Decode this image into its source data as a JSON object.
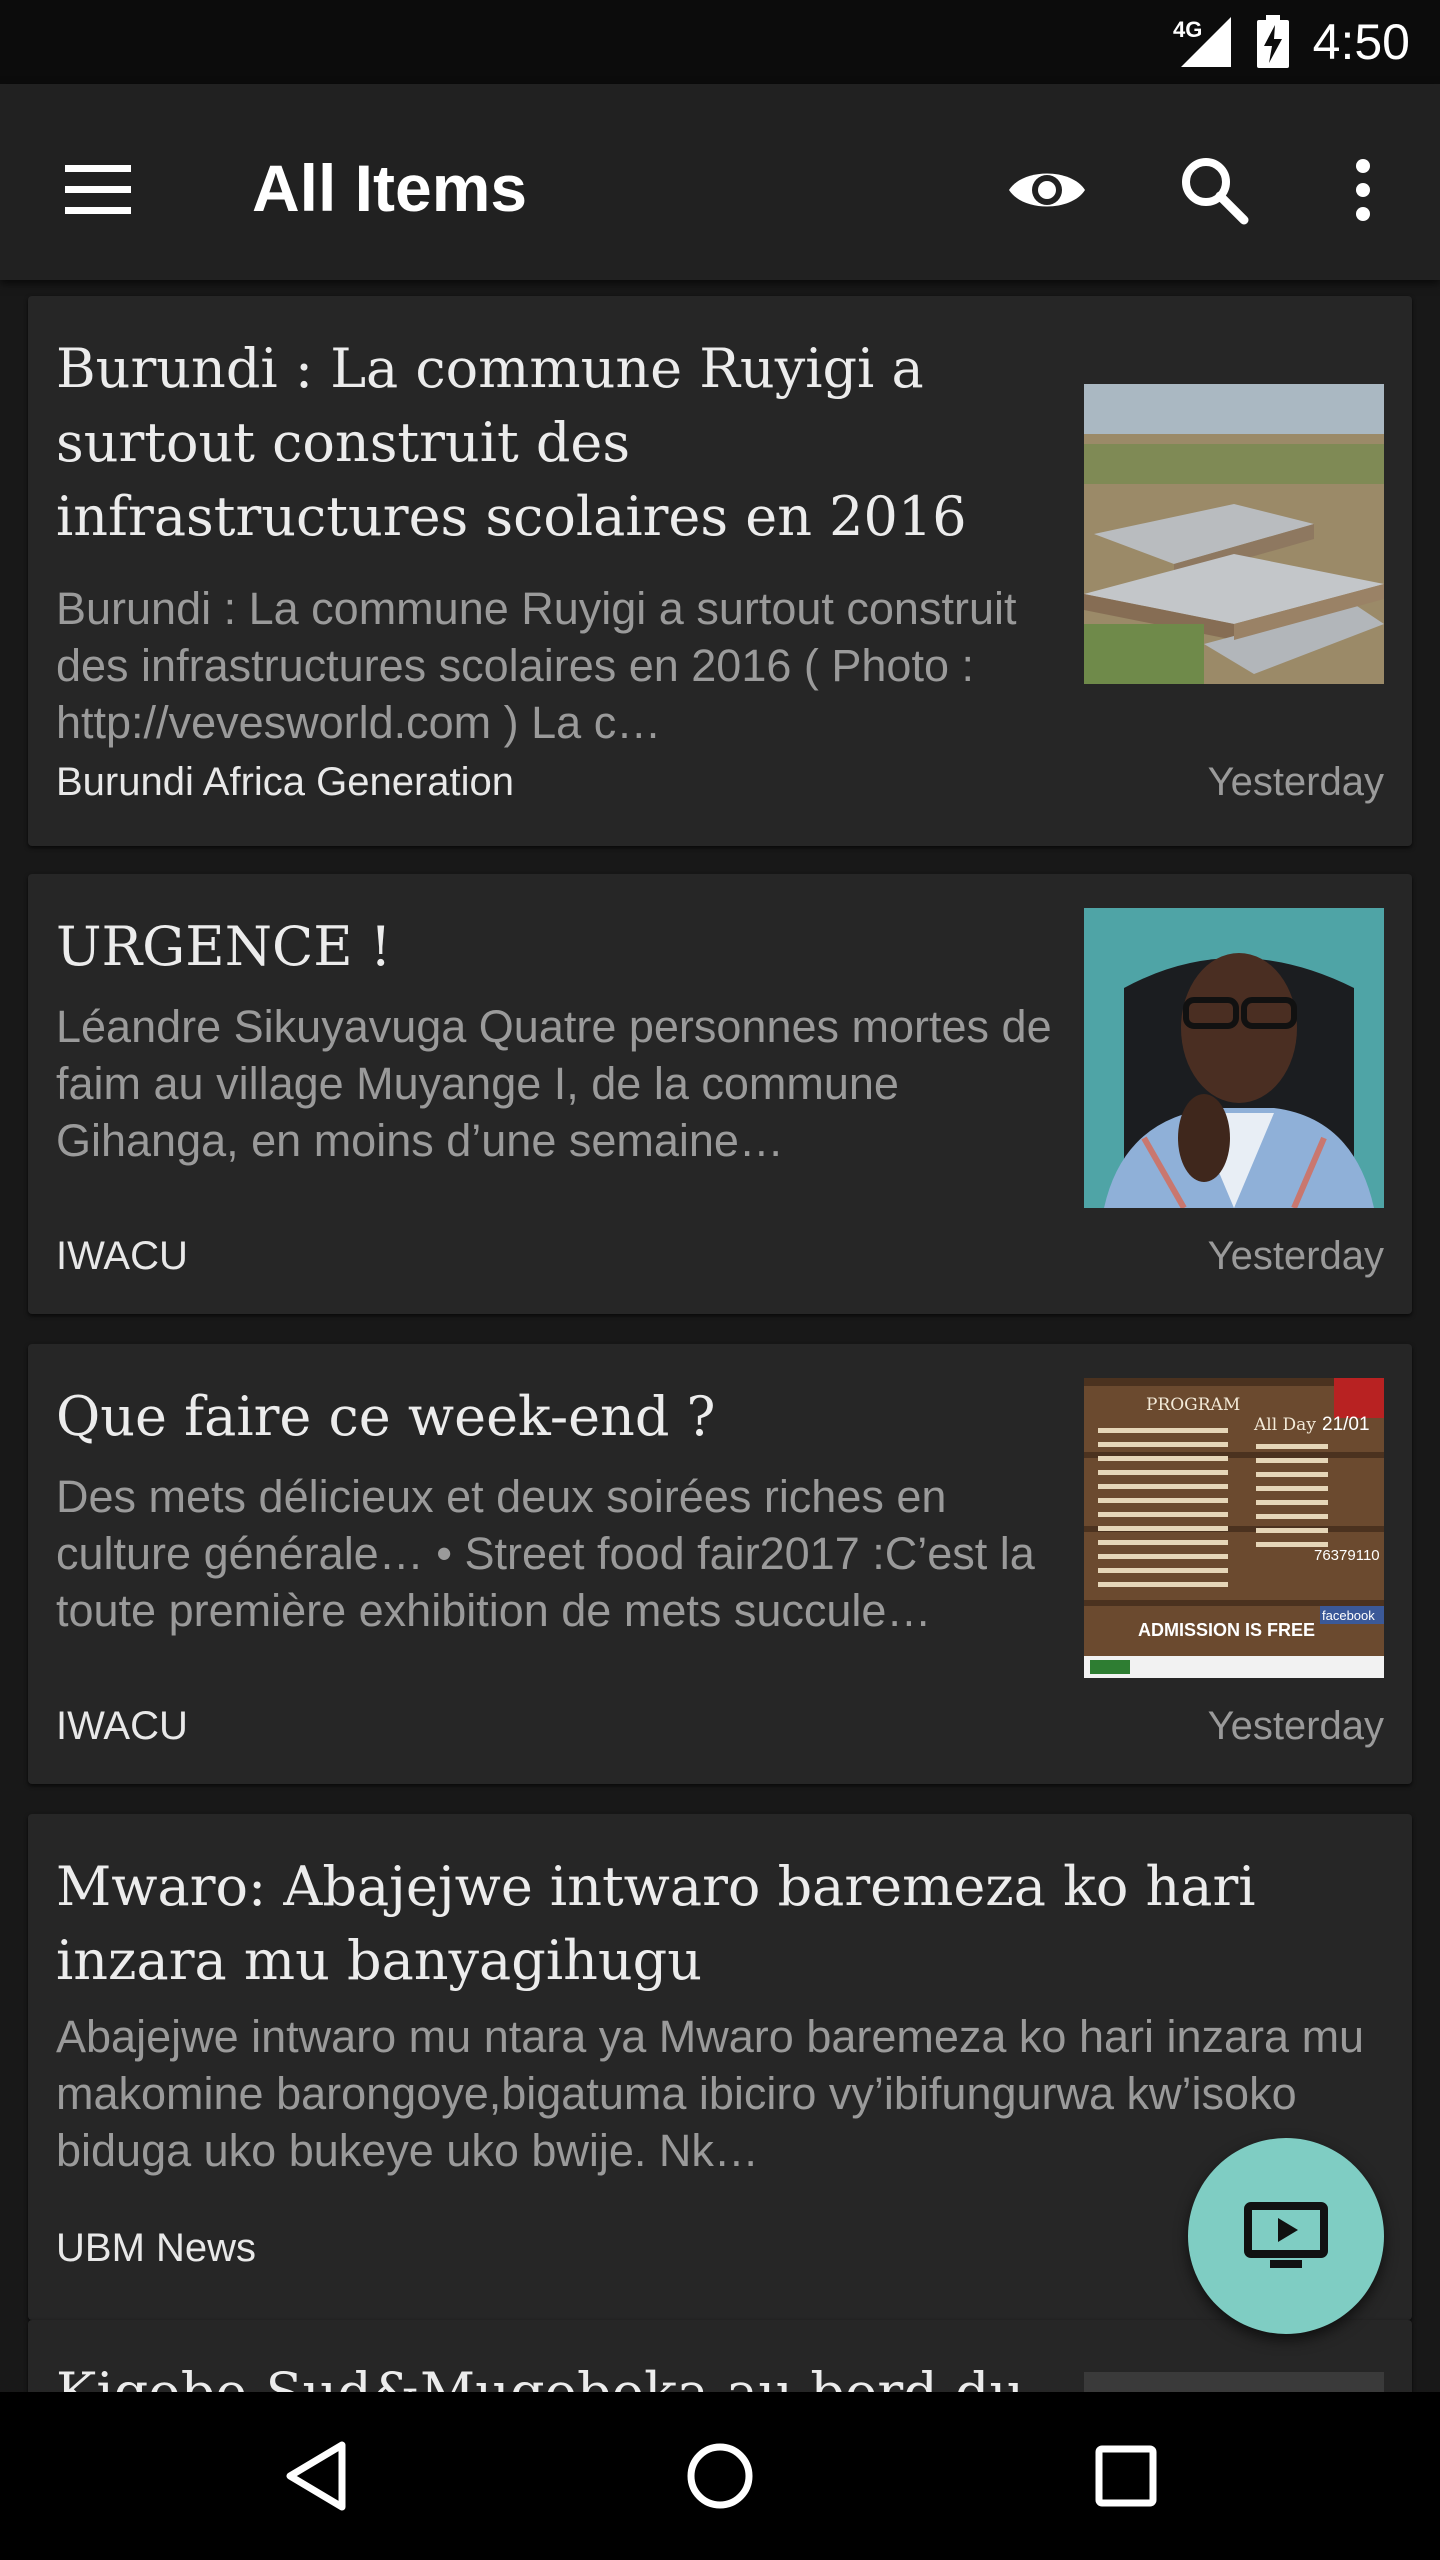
{
  "status_bar": {
    "network": "4G",
    "time": "4:50"
  },
  "app_bar": {
    "title": "All Items",
    "icons": [
      "menu-icon",
      "eye-icon",
      "search-icon",
      "more-vert-icon"
    ]
  },
  "articles": [
    {
      "title": "Burundi : La commune Ruyigi a surtout construit des infrastructures scolaires en 2016",
      "description": "Burundi : La commune Ruyigi a surtout construit des infrastructures scolaires en 2016 ( Photo : http://vevesworld.com ) La c…",
      "source": "Burundi Africa Generation",
      "date": "Yesterday"
    },
    {
      "title": "URGENCE !",
      "description": "Léandre Sikuyavuga Quatre personnes mortes de faim au village Muyange I, de la commune Gihanga, en moins d’une semaine…",
      "source": "IWACU",
      "date": "Yesterday"
    },
    {
      "title": "Que faire ce week-end ?",
      "description": "Des mets délicieux et deux soirées riches en culture générale… • Street food fair2017 :C’est la toute première exhibition de mets succule…",
      "source": "IWACU",
      "date": "Yesterday"
    },
    {
      "title": "Mwaro: Abajejwe intwaro baremeza ko hari inzara mu banyagihugu",
      "description": "Abajejwe intwaro mu ntara ya Mwaro baremeza ko hari inzara mu makomine barongoye,bigatuma ibiciro vy’ibifungurwa kw’isoko biduga uko bukeye uko bwije. Nk…",
      "source": "UBM News",
      "date": ""
    },
    {
      "title": "Kigobe-Sud&Mugoboka au bord du",
      "description": "",
      "source": "",
      "date": ""
    }
  ],
  "flyer_text": {
    "program": "PROGRAM",
    "all_day": "All Day",
    "date": "21/01",
    "admission": "ADMISSION IS FREE",
    "phone": "76379110",
    "facebook": "facebook"
  },
  "fab": {
    "icon": "slideshow-icon"
  },
  "nav_bar": {
    "icons": [
      "back-icon",
      "home-icon",
      "recents-icon"
    ]
  },
  "colors": {
    "accent": "#7fcdc3",
    "card": "#262626",
    "app_bar": "#212121"
  }
}
